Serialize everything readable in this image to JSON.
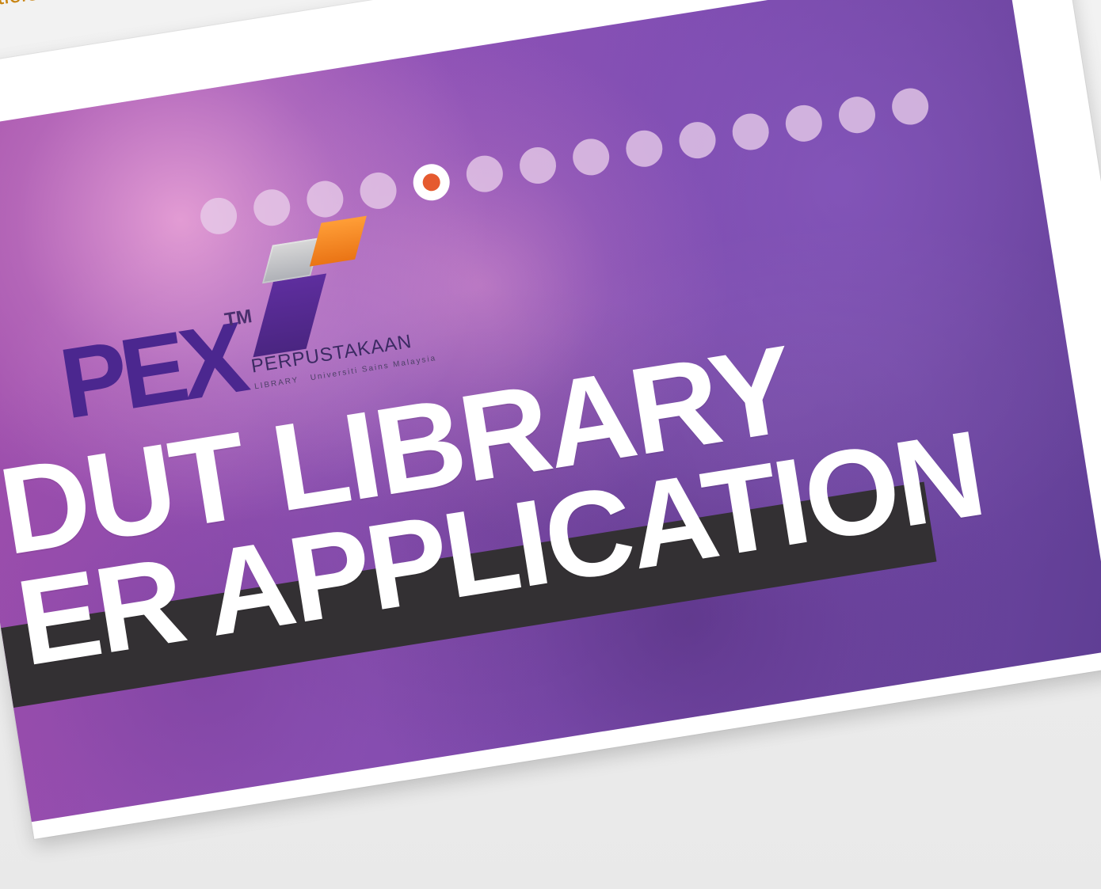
{
  "page": {
    "top_link_fragment": "ticle Rep"
  },
  "banner": {
    "brand_fragment": "PEX",
    "tm": "TM",
    "library_name": "PERPUSTAKAAN",
    "library_subtitle_left": "LIBRARY",
    "library_subtitle_right": "Universiti Sains Malaysia",
    "headline_line1": "DUT LIBRARY",
    "headline_line2": "ER APPLICATION",
    "indicator_count": 14,
    "active_indicator": 5
  },
  "colors": {
    "accent_link": "#c88412",
    "purple_brand": "#4b278f",
    "active_dot_outer": "#ffffff",
    "active_dot_inner": "#e55a2f",
    "dark_bar": "#333033"
  }
}
